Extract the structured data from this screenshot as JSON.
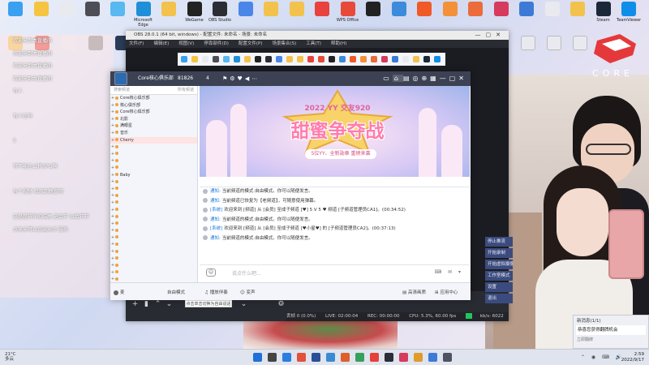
{
  "desktop": {
    "icons_top": [
      {
        "label": "",
        "color": "#3aa0f0"
      },
      {
        "label": "",
        "color": "#f5c542"
      },
      {
        "label": "",
        "color": "#e9eaf0"
      },
      {
        "label": "",
        "color": "#4c4d55"
      },
      {
        "label": "",
        "color": "#58b8f0"
      },
      {
        "label": "Microsoft Edge",
        "color": "#1f8fd8"
      },
      {
        "label": "",
        "color": "#f3c24d"
      },
      {
        "label": "WeGame",
        "color": "#222"
      },
      {
        "label": "OBS Studio",
        "color": "#2c2c34"
      },
      {
        "label": "",
        "color": "#4a86e8"
      },
      {
        "label": "",
        "color": "#f3c24d"
      },
      {
        "label": "",
        "color": "#f3c24d"
      },
      {
        "label": "",
        "color": "#e8413e"
      },
      {
        "label": "WPS Office",
        "color": "#e84a3a"
      },
      {
        "label": "",
        "color": "#222"
      },
      {
        "label": "",
        "color": "#3c8cdb"
      },
      {
        "label": "",
        "color": "#f05a28"
      },
      {
        "label": "",
        "color": "#f5903a"
      },
      {
        "label": "",
        "color": "#ec6b3a"
      },
      {
        "label": "",
        "color": "#d63a5c"
      },
      {
        "label": "",
        "color": "#3d7ad6"
      },
      {
        "label": "",
        "color": "#e9eaf0"
      },
      {
        "label": "",
        "color": "#f3c24d"
      },
      {
        "label": "Steam",
        "color": "#1b2838"
      },
      {
        "label": "TeamViewer",
        "color": "#0e8ee9"
      }
    ],
    "icons_second_row": [
      {
        "label": "",
        "color": "#f3c24d"
      },
      {
        "label": "",
        "color": "#e6403a"
      },
      {
        "label": "",
        "color": "#e9eaf0"
      },
      {
        "label": "",
        "color": "#888"
      },
      {
        "label": "",
        "color": "#2b3a55"
      }
    ],
    "icons_right_files": [
      {
        "label": "",
        "color": "#e9eaf0"
      },
      {
        "label": "",
        "color": "#e9eaf0"
      },
      {
        "label": "",
        "color": "#e9eaf0"
      }
    ]
  },
  "chat_overlay": {
    "lines": [
      {
        "badge": "",
        "name": "",
        "text": "欢迎来到本直播间",
        "badge_style": "b3"
      },
      {
        "badge": "",
        "name": "",
        "text": "欢迎来到本直播间",
        "badge_style": "b3"
      },
      {
        "badge": "",
        "name": "",
        "text": "欢迎来到本直播间",
        "badge_style": "b2"
      },
      {
        "badge": "",
        "name": "",
        "text": "欢迎来到本直播间",
        "badge_style": "b3"
      },
      {
        "badge": "",
        "name": "",
        "text": "有人",
        "badge_style": "b2"
      },
      {
        "badge": "",
        "name": "",
        "text": "",
        "badge_style": "b"
      },
      {
        "badge": "",
        "name": "",
        "text": "有人在吗",
        "badge_style": "b2"
      },
      {
        "badge": "",
        "name": "",
        "text": "",
        "badge_style": "b"
      },
      {
        "badge": "",
        "name": "",
        "text": "5",
        "badge_style": "b2"
      },
      {
        "badge": "",
        "name": "",
        "text": "",
        "badge_style": "b"
      },
      {
        "badge": "",
        "name": "",
        "text": "可不能在公打RPG啊",
        "badge_style": "b2"
      },
      {
        "badge": "",
        "name": "",
        "text": "",
        "badge_style": "b"
      },
      {
        "badge": "",
        "name": "",
        "text": "有个视频 我就到晚直明",
        "badge_style": "b2"
      },
      {
        "badge": "",
        "name": "",
        "text": "",
        "badge_style": "b"
      },
      {
        "badge": "",
        "name": "",
        "text": "这是是符命的结尾 进会开 似给开开",
        "badge_style": "b"
      },
      {
        "badge": "",
        "name": "",
        "text": "点来来可以说出来点 服务",
        "badge_style": "b"
      },
      {
        "badge": "",
        "name": "",
        "text": "",
        "badge_style": "b3"
      },
      {
        "badge": "",
        "name": "",
        "text": "",
        "badge_style": "b3"
      },
      {
        "badge": "",
        "name": "",
        "text": "",
        "badge_style": "b2"
      },
      {
        "badge": "",
        "name": "",
        "text": "",
        "badge_style": "b2"
      }
    ]
  },
  "obs": {
    "title": "OBS 28.0.1 (64 bit, windows) - 配置文件: 未命名 - 场景: 未命名",
    "menu": [
      "文件(F)",
      "编辑(E)",
      "视图(V)",
      "停靠部件(D)",
      "配置文件(P)",
      "场景集合(S)",
      "工具(T)",
      "帮助(H)"
    ],
    "controls": [
      "停止推流",
      "开始录制",
      "开始虚拟摄像机",
      "工作室模式",
      "设置",
      "退出"
    ],
    "status": {
      "dropped": "丢帧 0 (0.0%)",
      "live": "LIVE: 02:00:04",
      "rec": "REC: 00:00:00",
      "cpu": "CPU: 5.3%, 60.00 fps",
      "kbps": "kb/s: 6022"
    }
  },
  "yy": {
    "header": {
      "title": "Core核心俱乐部",
      "channel_id": "81826",
      "online_count": "4"
    },
    "search_placeholder": "搜索频道",
    "channel_list_header": "所有频道",
    "channels": [
      {
        "label": "Core核心俱乐部",
        "sel": false
      },
      {
        "label": "核心俱乐部",
        "sel": false
      },
      {
        "label": "Core核心俱乐部",
        "sel": false
      },
      {
        "label": "北影",
        "sel": false
      },
      {
        "label": "满眼星",
        "sel": false
      },
      {
        "label": "音乐",
        "sel": false
      },
      {
        "label": "Cherry",
        "sel": true
      },
      {
        "label": "",
        "sel": false
      },
      {
        "label": "",
        "sel": false
      },
      {
        "label": "",
        "sel": false
      },
      {
        "label": "",
        "sel": false
      },
      {
        "label": "Baby",
        "sel": false
      },
      {
        "label": "",
        "sel": false
      },
      {
        "label": "",
        "sel": false
      },
      {
        "label": "",
        "sel": false
      },
      {
        "label": "",
        "sel": false
      },
      {
        "label": "",
        "sel": false
      },
      {
        "label": "",
        "sel": false
      },
      {
        "label": "",
        "sel": false
      },
      {
        "label": "",
        "sel": false
      },
      {
        "label": "",
        "sel": false
      },
      {
        "label": "",
        "sel": false
      },
      {
        "label": "",
        "sel": false
      },
      {
        "label": "",
        "sel": false
      },
      {
        "label": "",
        "sel": false
      },
      {
        "label": "",
        "sel": false
      },
      {
        "label": "",
        "sel": false
      },
      {
        "label": "",
        "sel": false
      }
    ],
    "banner": {
      "subtitle": "2022 YY 交友920",
      "title": "甜蜜争夺战",
      "tagline": "5位YY、全新勋章 重磅来袭"
    },
    "messages": [
      {
        "tag": "通知:",
        "text": "当前频道的模式:自由模式。你可以随便发言。"
      },
      {
        "tag": "通知:",
        "text": "当前频道已恢复为【老频道】，可随意使用弹幕。"
      },
      {
        "tag": "[系统]",
        "text": "欢迎来到 [频道] 从 [会员] 至成子频道 [♥] 5 V 5 ♥ 频道 [子频道管理员CA1]。(00:34:52)"
      },
      {
        "tag": "通知:",
        "text": "当前频道的模式:自由模式。你可以随便发言。"
      },
      {
        "tag": "[系统]",
        "text": "欢迎来到 [频道] 从 [会员] 至成子频道 [♥小星♥] 的 [子频道管理员CA2]。(00:37:13)"
      },
      {
        "tag": "通知:",
        "text": "当前频道的模式:自由模式。你可以随便发言。"
      }
    ],
    "input_placeholder": "说点什么吧...",
    "footer": {
      "mode": "自由模式",
      "btn_mic": "麦",
      "btn_apply": "按住F2说话",
      "btn_music": "播放伴奏",
      "btn_voice": "变声",
      "btn_quality": "高清画质",
      "btn_apps": "应用中心"
    },
    "tooltip": "点击单击切换为自由说话"
  },
  "brand": {
    "text": "CORE"
  },
  "notification": {
    "title": "新消息(1/1)",
    "body": "恭喜您获得翻牌机会",
    "footer": "立即翻牌"
  },
  "taskbar": {
    "weather_temp": "21°C",
    "weather_desc": "多云",
    "time": "2:59",
    "date": "2022/9/17",
    "apps": [
      "#1f6fd8",
      "#444",
      "#2a7de1",
      "#e2513b",
      "#2b4f97",
      "#3a8ad3",
      "#dd5f2b",
      "#37a05a",
      "#e6403a",
      "#2b2e38",
      "#d63a5c",
      "#e09b2a",
      "#3d7ad6",
      "#4e5362"
    ]
  }
}
